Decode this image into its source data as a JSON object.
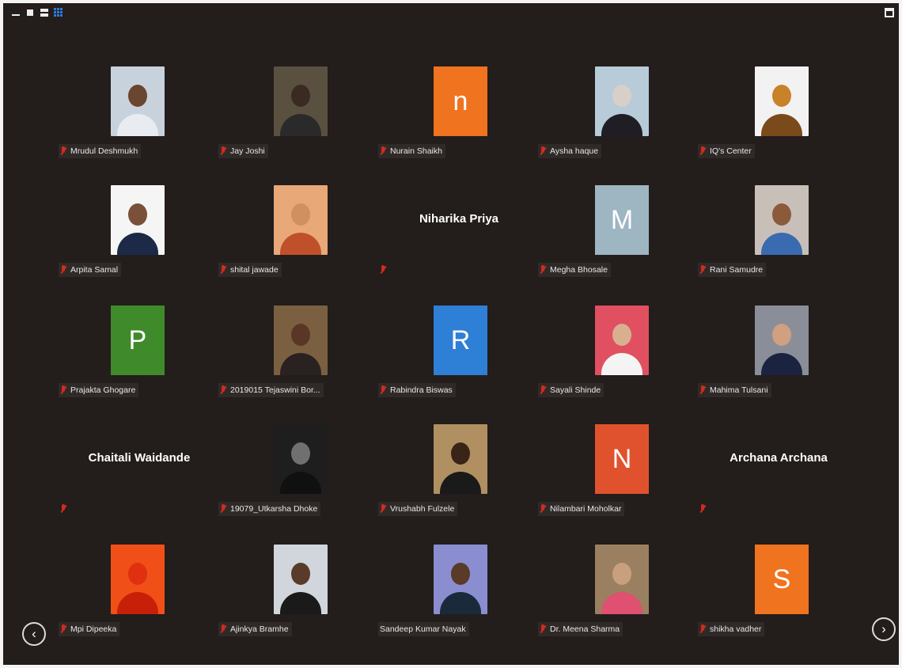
{
  "toolbar": {
    "view_icons": [
      "minimize-icon",
      "speaker-view-icon",
      "split-view-icon",
      "gallery-view-icon"
    ],
    "accent_color": "#2a7be0",
    "fullscreen_icon": "exit-fullscreen-icon"
  },
  "participants": [
    {
      "name": "Mrudul Deshmukh",
      "type": "photo",
      "bg": "#c8d2dc",
      "skin": "#6a4530",
      "shirt": "#e8ecf0"
    },
    {
      "name": "Jay Joshi",
      "type": "photo",
      "bg": "#5a5040",
      "skin": "#3a2a22",
      "shirt": "#2a2a2a"
    },
    {
      "name": "Nurain Shaikh",
      "type": "letter",
      "letter": "n",
      "color": "#f0731f"
    },
    {
      "name": "Aysha haque",
      "type": "photo",
      "bg": "#b7cbd8",
      "skin": "#d8d0c8",
      "shirt": "#1e1e24"
    },
    {
      "name": "IQ's Center",
      "type": "photo",
      "bg": "#f2f2f2",
      "skin": "#c8822a",
      "shirt": "#7a4a1a"
    },
    {
      "name": "Arpita Samal",
      "type": "photo",
      "bg": "#f5f5f5",
      "skin": "#7a5038",
      "shirt": "#1c2a48"
    },
    {
      "name": "shital jawade",
      "type": "photo",
      "bg": "#e8a878",
      "skin": "#d09060",
      "shirt": "#c0502a"
    },
    {
      "name": "",
      "display": "Niharika Priya",
      "type": "name"
    },
    {
      "name": "Megha Bhosale",
      "type": "letter",
      "letter": "M",
      "color": "#9eb5c2"
    },
    {
      "name": "Rani Samudre",
      "type": "photo",
      "bg": "#c8c0b8",
      "skin": "#8a5a3a",
      "shirt": "#3a6ab0"
    },
    {
      "name": "Prajakta Ghogare",
      "type": "letter",
      "letter": "P",
      "color": "#3f8a2a"
    },
    {
      "name": "2019015 Tejaswini Bor...",
      "type": "photo",
      "bg": "#7a6040",
      "skin": "#5a3626",
      "shirt": "#2a2220"
    },
    {
      "name": "Rabindra Biswas",
      "type": "letter",
      "letter": "R",
      "color": "#2e7fd6"
    },
    {
      "name": "Sayali Shinde",
      "type": "photo",
      "bg": "#e05060",
      "skin": "#d8b090",
      "shirt": "#f4f4f4"
    },
    {
      "name": "Mahima Tulsani",
      "type": "photo",
      "bg": "#8a8e98",
      "skin": "#d0a080",
      "shirt": "#1a2440"
    },
    {
      "name": "",
      "display": "Chaitali Waidande",
      "type": "name"
    },
    {
      "name": "19079_Utkarsha Dhoke",
      "type": "photo",
      "bg": "#1e1e1e",
      "skin": "#707070",
      "shirt": "#101010"
    },
    {
      "name": "Vrushabh Fulzele",
      "type": "photo",
      "bg": "#b09060",
      "skin": "#3a2418",
      "shirt": "#1a1a1a"
    },
    {
      "name": "Nilambari Moholkar",
      "type": "letter",
      "letter": "N",
      "color": "#e0522e"
    },
    {
      "name": "",
      "display": "Archana Archana",
      "type": "name"
    },
    {
      "name": "Mpi Dipeeka",
      "type": "photo",
      "bg": "#f05018",
      "skin": "#e03010",
      "shirt": "#c82008"
    },
    {
      "name": "Ajinkya Bramhe",
      "type": "photo",
      "bg": "#d0d6dc",
      "skin": "#5a3a28",
      "shirt": "#1a1a1a"
    },
    {
      "name": "Sandeep Kumar Nayak",
      "type": "photo",
      "bg": "#8a8ed0",
      "skin": "#5a3a28",
      "shirt": "#1a2a3a",
      "no_mic": true
    },
    {
      "name": "Dr. Meena Sharma",
      "type": "photo",
      "bg": "#9a8060",
      "skin": "#c8a080",
      "shirt": "#e05070"
    },
    {
      "name": "shikha vadher",
      "type": "letter",
      "letter": "S",
      "color": "#f0731f"
    }
  ],
  "nav": {
    "prev_glyph": "‹",
    "next_glyph": "›"
  }
}
